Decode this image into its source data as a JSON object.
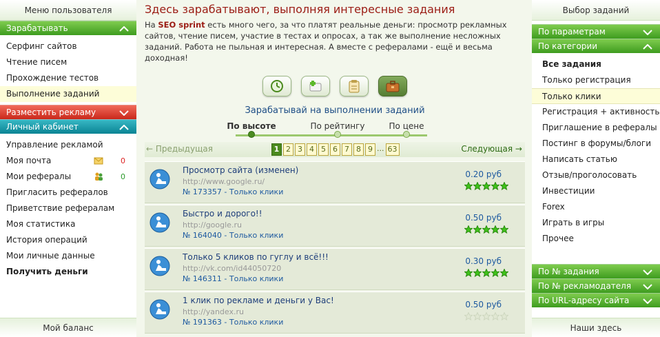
{
  "left": {
    "header": "Меню пользователя",
    "earn_bar": "Зарабатывать",
    "earn_items": [
      "Серфинг сайтов",
      "Чтение писем",
      "Прохождение тестов",
      "Выполнение заданий"
    ],
    "advertise_bar": "Разместить рекламу",
    "cabinet_bar": "Личный кабинет",
    "cabinet_items": [
      {
        "label": "Управление рекламой"
      },
      {
        "label": "Моя почта",
        "count": "0"
      },
      {
        "label": "Мои рефералы",
        "count": "0"
      },
      {
        "label": "Пригласить рефералов"
      },
      {
        "label": "Приветствие рефералам"
      },
      {
        "label": "Моя статистика"
      },
      {
        "label": "История операций"
      },
      {
        "label": "Мои личные данные"
      },
      {
        "label": "Получить деньги"
      }
    ],
    "footer": "Мой баланс"
  },
  "main": {
    "title": "Здесь зарабатывают, выполняя интересные задания",
    "intro_prefix": "На ",
    "intro_brand": "SEO sprint",
    "intro_rest": " есть много чего, за что платят реальные деньги: просмотр рекламных сайтов, чтение писем, участие в тестах и опросах, а так же выполнение несложных заданий. Работа не пыльная и интересная. А вместе с рефералами - ещё и весьма доходная!",
    "icons": [
      "clock-icon",
      "add-icon",
      "clipboard-icon",
      "briefcase-icon"
    ],
    "subtitle": "Зарабатывай на выполнении заданий",
    "sort": [
      "По высоте",
      "По рейтингу",
      "По цене"
    ],
    "pager": {
      "prev": "← Предыдущая",
      "next": "Следующая →",
      "pages": [
        "1",
        "2",
        "3",
        "4",
        "5",
        "6",
        "7",
        "8",
        "9",
        "...",
        "63"
      ]
    },
    "tasks": [
      {
        "title": "Просмотр сайта (изменен)",
        "url": "http://www.google.ru/",
        "id": "№ 173357 - Только клики",
        "price": "0.20 руб",
        "rating": 5
      },
      {
        "title": "Быстро и дорого!!",
        "url": "http://google.ru",
        "id": "№ 164040 - Только клики",
        "price": "0.50 руб",
        "rating": 5
      },
      {
        "title": "Только 5 кликов по гуглу и всё!!!",
        "url": "http://vk.com/id44050720",
        "id": "№ 146311 - Только клики",
        "price": "0.30 руб",
        "rating": 5
      },
      {
        "title": "1 клик по рекламе и деньги у Вас!",
        "url": "http://yandex.ru",
        "id": "№ 191363 - Только клики",
        "price": "0.50 руб",
        "rating": 0
      }
    ]
  },
  "right": {
    "header": "Выбор заданий",
    "param_bar": "По параметрам",
    "category_bar": "По категории",
    "categories": [
      "Все задания",
      "Только регистрация",
      "Только клики",
      "Регистрация + активность",
      "Приглашение в рефералы",
      "Постинг в форумы/блоги",
      "Написать статью",
      "Отзыв/проголосовать",
      "Инвестиции",
      "Forex",
      "Играть в игры",
      "Прочее"
    ],
    "search_bars": [
      "По № задания",
      "По № рекламодателя",
      "По URL-адресу сайта"
    ],
    "footer": "Наши здесь"
  },
  "colors": {
    "accent_green": "#3e9c1f",
    "accent_red": "#c9281b",
    "accent_teal": "#0a8494",
    "title_red": "#9b1c14",
    "link_blue": "#1e5aa0"
  }
}
